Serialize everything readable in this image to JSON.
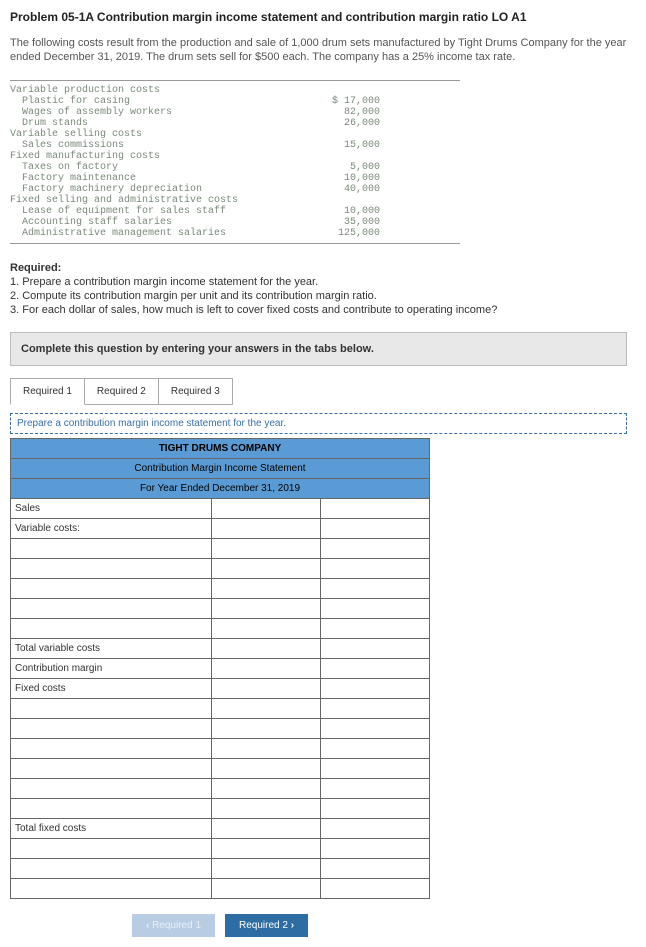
{
  "title": "Problem 05-1A Contribution margin income statement and contribution margin ratio LO A1",
  "intro": "The following costs result from the production and sale of 1,000 drum sets manufactured by Tight Drums Company for the year ended December 31, 2019. The drum sets sell for $500 each. The company has a 25% income tax rate.",
  "costs": {
    "groups": [
      {
        "header": "Variable production costs",
        "items": [
          {
            "label": "  Plastic for casing",
            "value": "$ 17,000"
          },
          {
            "label": "  Wages of assembly workers",
            "value": "82,000"
          },
          {
            "label": "  Drum stands",
            "value": "26,000"
          }
        ]
      },
      {
        "header": "Variable selling costs",
        "items": [
          {
            "label": "  Sales commissions",
            "value": "15,000"
          }
        ]
      },
      {
        "header": "Fixed manufacturing costs",
        "items": [
          {
            "label": "  Taxes on factory",
            "value": "5,000"
          },
          {
            "label": "  Factory maintenance",
            "value": "10,000"
          },
          {
            "label": "  Factory machinery depreciation",
            "value": "40,000"
          }
        ]
      },
      {
        "header": "Fixed selling and administrative costs",
        "items": [
          {
            "label": "  Lease of equipment for sales staff",
            "value": "10,000"
          },
          {
            "label": "  Accounting staff salaries",
            "value": "35,000"
          },
          {
            "label": "  Administrative management salaries",
            "value": "125,000"
          }
        ]
      }
    ]
  },
  "required": {
    "heading": "Required:",
    "items": [
      "1. Prepare a contribution margin income statement for the year.",
      "2. Compute its contribution margin per unit and its contribution margin ratio.",
      "3. For each dollar of sales, how much is left to cover fixed costs and contribute to operating income?"
    ]
  },
  "instruction": "Complete this question by entering your answers in the tabs below.",
  "tabs": [
    "Required 1",
    "Required 2",
    "Required 3"
  ],
  "prompt": "Prepare a contribution margin income statement for the year.",
  "sheet": {
    "h1": "TIGHT DRUMS COMPANY",
    "h2": "Contribution Margin Income Statement",
    "h3": "For Year Ended December 31, 2019",
    "rows": [
      "Sales",
      "Variable costs:",
      "",
      "",
      "",
      "",
      "",
      "Total variable costs",
      "Contribution margin",
      "Fixed costs",
      "",
      "",
      "",
      "",
      "",
      "",
      "Total fixed costs",
      "",
      "",
      ""
    ]
  },
  "nav": {
    "prev": "Required 1",
    "next": "Required 2"
  }
}
